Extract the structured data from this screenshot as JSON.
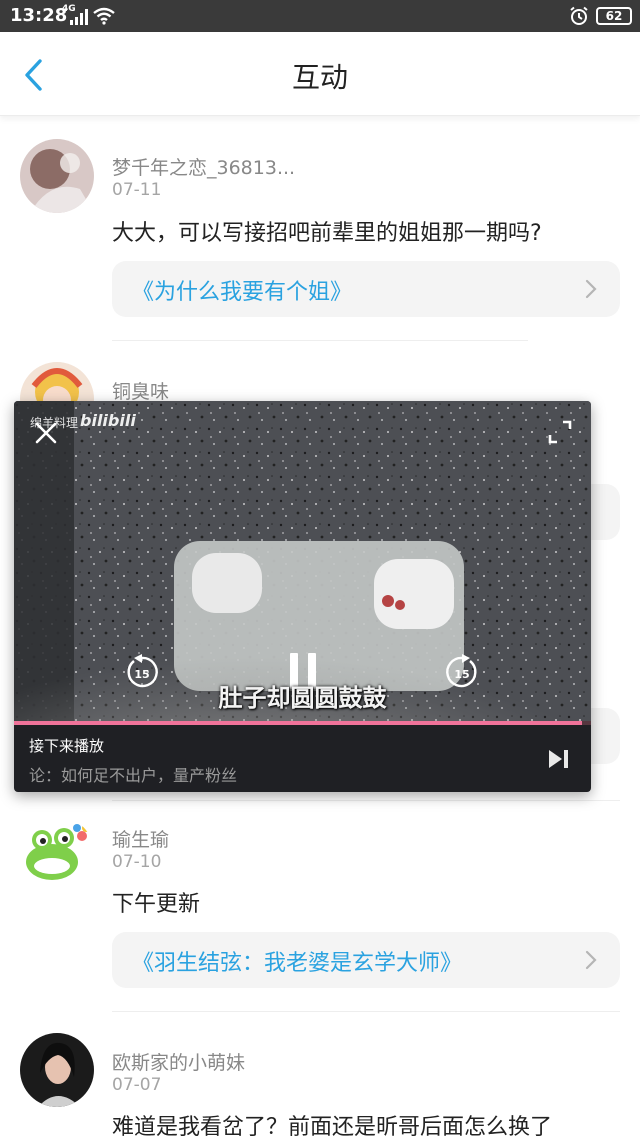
{
  "status_bar": {
    "time": "13:28",
    "network": "4G",
    "battery": "62"
  },
  "nav": {
    "title": "互动"
  },
  "comments": [
    {
      "name": "梦千年之恋_36813...",
      "date": "07-11",
      "text": "大大，可以写接招吧前辈里的姐姐那一期吗?",
      "link": "《为什么我要有个姐》"
    },
    {
      "name": "铜臭味"
    },
    {
      "name": "瑜生瑜",
      "date": "07-10",
      "text": "下午更新",
      "link": "《羽生结弦：我老婆是玄学大师》"
    },
    {
      "name": "欧斯家的小萌妹",
      "date": "07-07",
      "text": "难道是我看岔了？前面还是昕哥后面怎么换了"
    }
  ],
  "video": {
    "watermark": "绵羊料理",
    "logo": "bilibili",
    "subtitle": "肚子却圆圆鼓鼓",
    "progress": 0.985,
    "rewind_seconds": "15",
    "forward_seconds": "15",
    "up_next_label": "接下来播放",
    "up_next_title": "论：如何足不出户，量产粉丝"
  },
  "colors": {
    "link": "#2aa2e0",
    "accent": "#f0739a",
    "status_bar": "#3a3a3a"
  }
}
